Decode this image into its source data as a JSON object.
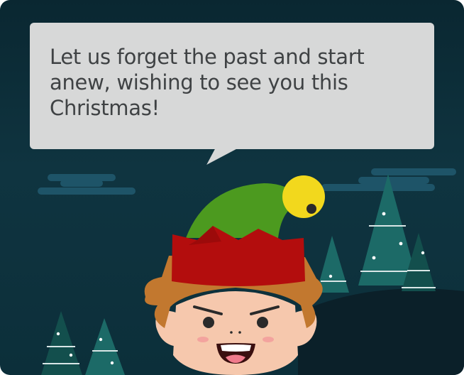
{
  "message": {
    "text": "Let us forget the past and start anew, wishing to see you this Christmas!"
  },
  "colors": {
    "background": "#0f3440",
    "bubble": "#d7d8d8",
    "text": "#3f4244",
    "hat_green": "#4c9a1f",
    "hat_red": "#b30d0d",
    "bell": "#f2d81d",
    "tree": "#1c6a67",
    "skin": "#f6c8ad",
    "hair": "#c2782f"
  }
}
